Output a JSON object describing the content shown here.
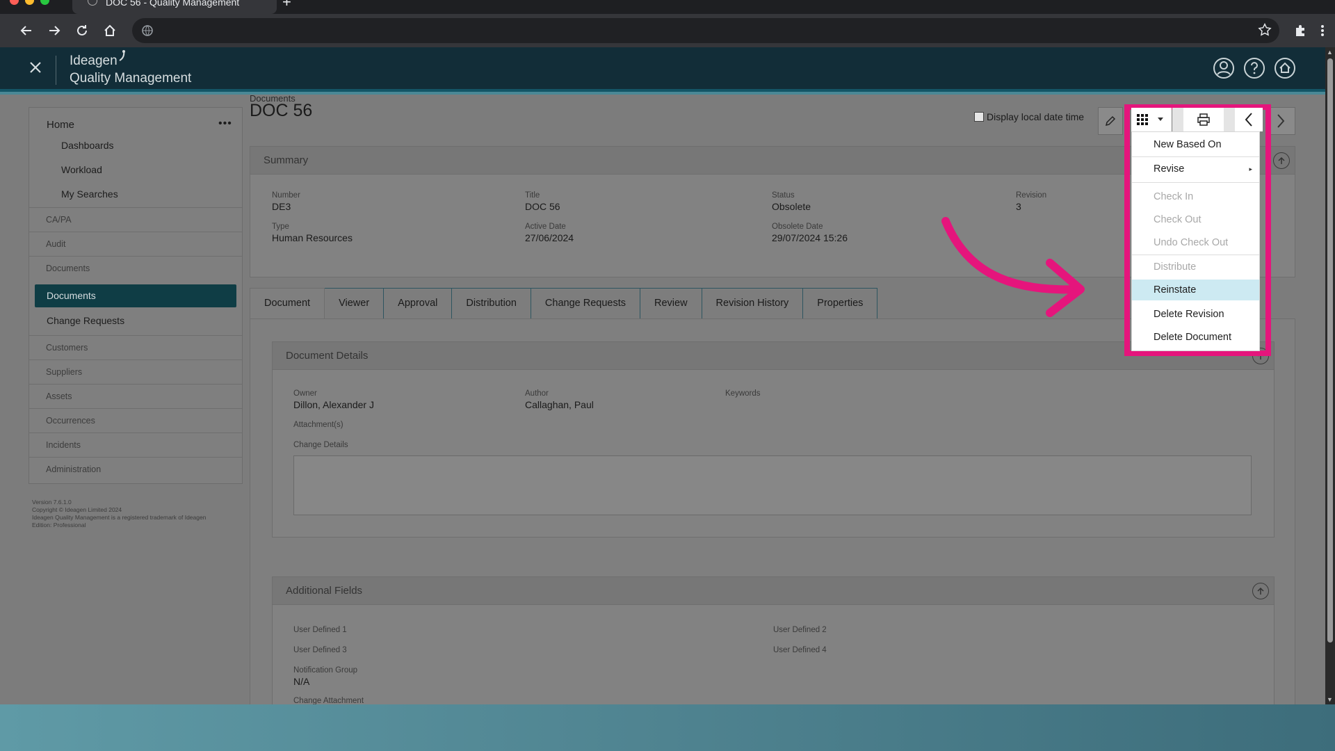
{
  "browser": {
    "tab_title": "DOC 56 - Quality Management",
    "new_tab": "+"
  },
  "app": {
    "brand_line1": "Ideagen",
    "brand_line2": "Quality Management"
  },
  "sidebar": {
    "home": "Home",
    "more": "•••",
    "home_items": [
      "Dashboards",
      "Workload",
      "My Searches"
    ],
    "sections": [
      "CA/PA",
      "Audit",
      "Documents"
    ],
    "documents_items": [
      "Documents",
      "Change Requests"
    ],
    "sections2": [
      "Customers",
      "Suppliers",
      "Assets",
      "Occurrences",
      "Incidents",
      "Administration"
    ],
    "footer": {
      "version": "Version 7.6.1.0",
      "copyright": "Copyright © Ideagen Limited 2024",
      "trademark": "Ideagen Quality Management is a registered trademark of Ideagen",
      "edition": "Edition: Professional"
    }
  },
  "page": {
    "breadcrumb": "Documents",
    "title": "DOC 56",
    "local_date_label": "Display local date time"
  },
  "summary": {
    "header": "Summary",
    "number_label": "Number",
    "number": "DE3",
    "title_label": "Title",
    "title": "DOC 56",
    "status_label": "Status",
    "status": "Obsolete",
    "revision_label": "Revision",
    "revision": "3",
    "type_label": "Type",
    "type": "Human Resources",
    "active_date_label": "Active Date",
    "active_date": "27/06/2024",
    "obsolete_date_label": "Obsolete Date",
    "obsolete_date": "29/07/2024 15:26"
  },
  "tabs": [
    "Document",
    "Viewer",
    "Approval",
    "Distribution",
    "Change Requests",
    "Review",
    "Revision History",
    "Properties"
  ],
  "document_details": {
    "header": "Document Details",
    "owner_label": "Owner",
    "owner": "Dillon, Alexander J",
    "author_label": "Author",
    "author": "Callaghan, Paul",
    "keywords_label": "Keywords",
    "attachments_label": "Attachment(s)",
    "change_details_label": "Change Details"
  },
  "additional_fields": {
    "header": "Additional Fields",
    "ud1": "User Defined 1",
    "ud2": "User Defined 2",
    "ud3": "User Defined 3",
    "ud4": "User Defined 4",
    "notification_group_label": "Notification Group",
    "notification_group": "N/A",
    "change_attachment_label": "Change Attachment"
  },
  "menu": {
    "items": [
      {
        "label": "New Based On",
        "state": "enabled"
      },
      {
        "label": "Revise",
        "state": "enabled",
        "submenu": true
      },
      {
        "label": "Check In",
        "state": "disabled"
      },
      {
        "label": "Check Out",
        "state": "disabled"
      },
      {
        "label": "Undo Check Out",
        "state": "disabled"
      },
      {
        "label": "Distribute",
        "state": "disabled"
      },
      {
        "label": "Reinstate",
        "state": "hover"
      },
      {
        "label": "Delete Revision",
        "state": "enabled"
      },
      {
        "label": "Delete Document",
        "state": "enabled"
      }
    ]
  },
  "colors": {
    "highlight": "#e5157c",
    "arrow": "#e5157c",
    "active_nav": "#0f3d45",
    "menu_hover": "#cdeaf2"
  }
}
